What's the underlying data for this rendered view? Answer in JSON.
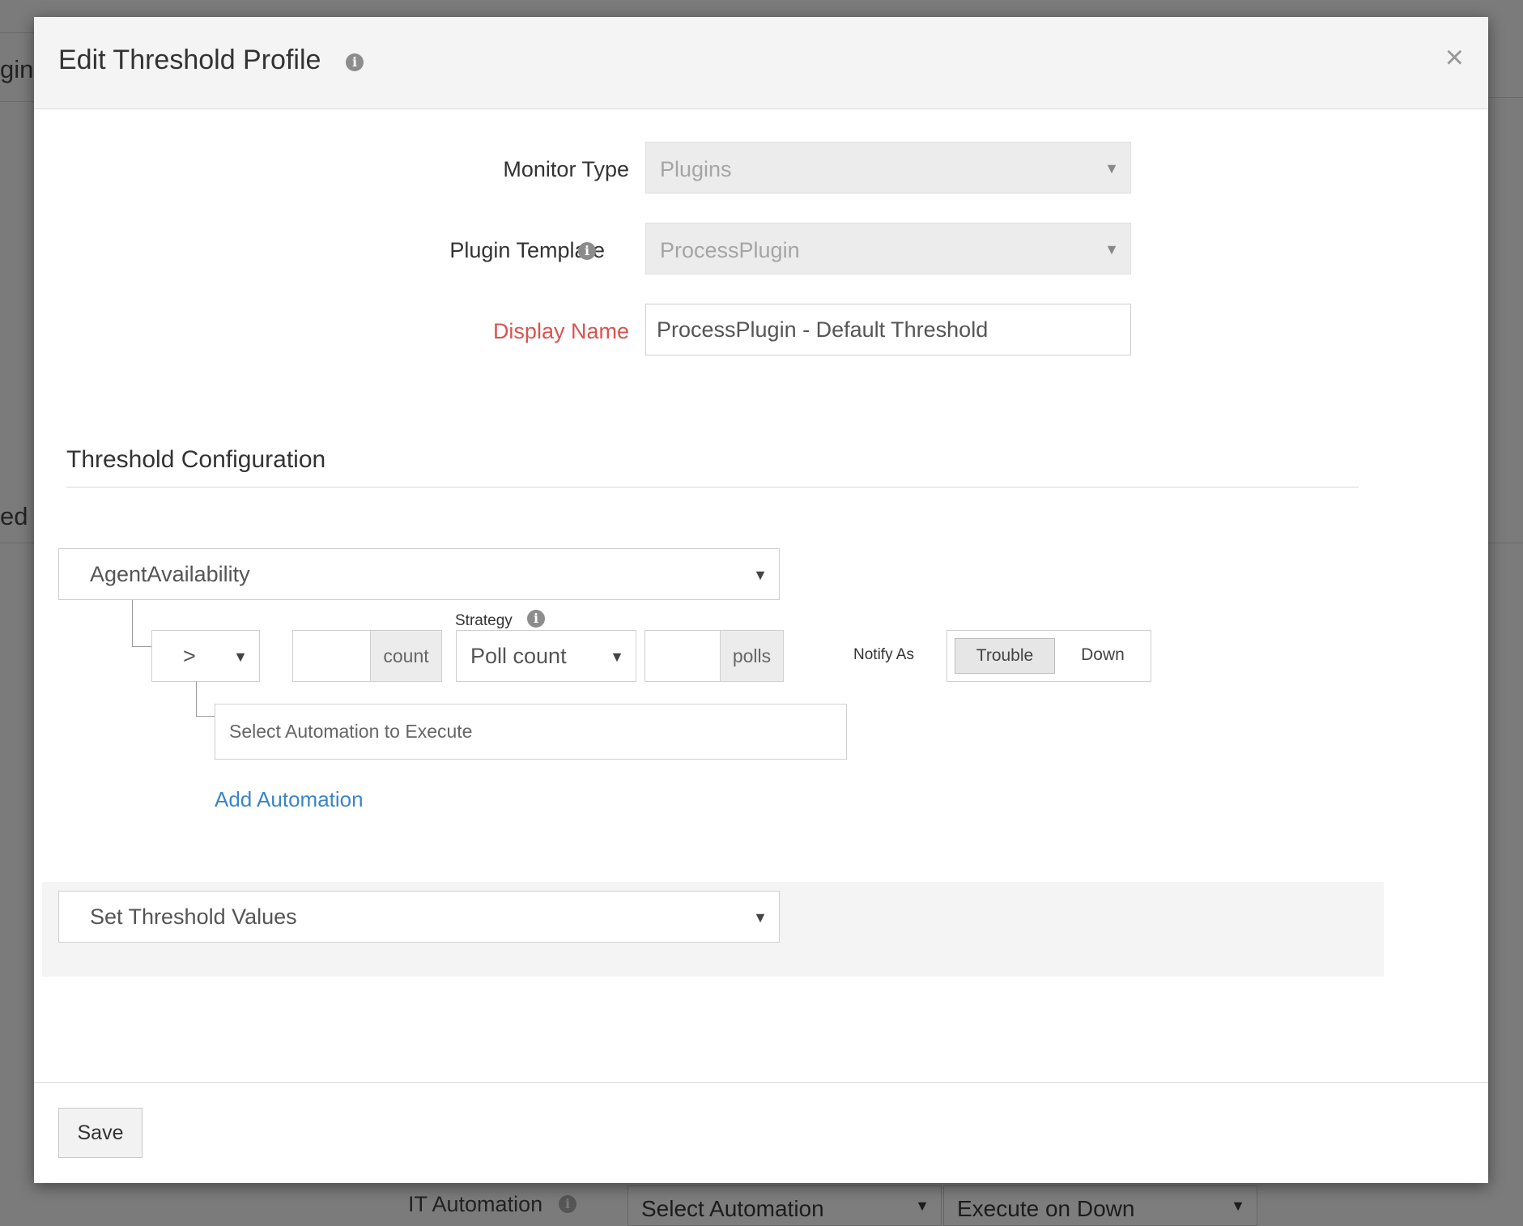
{
  "background": {
    "fragment_top": "gin",
    "fragment_mid": "ed C",
    "it_automation_label": "IT Automation",
    "select_automation": "Select Automation",
    "execute_on": "Execute on Down"
  },
  "modal": {
    "title": "Edit Threshold Profile",
    "close": "×"
  },
  "form": {
    "monitor_type_label": "Monitor Type",
    "monitor_type_value": "Plugins",
    "plugin_template_label": "Plugin Template",
    "plugin_template_value": "ProcessPlugin",
    "display_name_label": "Display Name",
    "display_name_value": "ProcessPlugin - Default Threshold"
  },
  "threshold": {
    "section_title": "Threshold Configuration",
    "attribute": "AgentAvailability",
    "operator": ">",
    "count_value": "",
    "count_addon": "count",
    "strategy_label": "Strategy",
    "strategy_value": "Poll count",
    "polls_value": "",
    "polls_addon": "polls",
    "notify_label": "Notify As",
    "notify_options": [
      "Trouble",
      "Down"
    ],
    "notify_selected": "Trouble",
    "automation_placeholder": "Select Automation to Execute",
    "add_automation": "Add Automation",
    "set_values": "Set Threshold Values"
  },
  "footer": {
    "save": "Save"
  }
}
